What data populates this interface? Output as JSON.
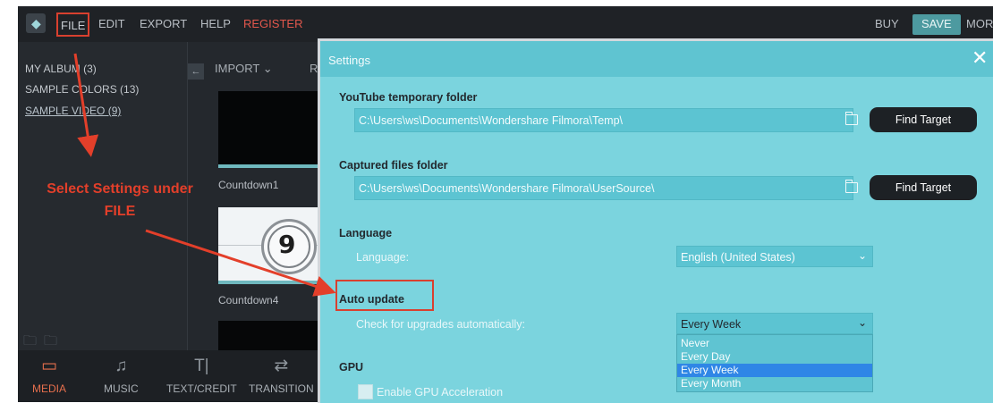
{
  "menubar": {
    "items": [
      "FILE",
      "EDIT",
      "EXPORT",
      "HELP",
      "REGISTER"
    ],
    "right": [
      "BUY",
      "SAVE",
      "MOR"
    ]
  },
  "library": {
    "albums": [
      "MY ALBUM (3)",
      "SAMPLE COLORS (13)",
      "SAMPLE VIDEO (9)"
    ]
  },
  "media": {
    "import_label": "IMPORT ⌄",
    "next_label_fragment": "R",
    "thumbnails": [
      "Countdown1",
      "Countdown4"
    ],
    "thumb_number": "9"
  },
  "bottom_tabs": [
    "MEDIA",
    "MUSIC",
    "TEXT/CREDIT",
    "TRANSITION"
  ],
  "annotation": {
    "line1": "Select Settings under",
    "line2": "FILE",
    "color": "#e33f2a"
  },
  "dialog": {
    "title": "Settings",
    "youtube": {
      "heading": "YouTube temporary folder",
      "path": "C:\\Users\\ws\\Documents\\Wondershare Filmora\\Temp\\",
      "button": "Find Target"
    },
    "captured": {
      "heading": "Captured files folder",
      "path": "C:\\Users\\ws\\Documents\\Wondershare Filmora\\UserSource\\",
      "button": "Find Target"
    },
    "language": {
      "heading": "Language",
      "label": "Language:",
      "value": "English (United States)"
    },
    "auto_update": {
      "heading": "Auto update",
      "label": "Check for upgrades automatically:",
      "value": "Every Week",
      "options": [
        "Never",
        "Every Day",
        "Every Week",
        "Every Month"
      ],
      "selected_index": 2
    },
    "gpu": {
      "heading": "GPU",
      "checkbox_label": "Enable GPU Acceleration",
      "checked": false
    }
  },
  "colors": {
    "dialog_bg": "#7bd4de",
    "app_bg": "#24282d",
    "accent_red": "#d9402f",
    "selection_blue": "#2f86e6"
  }
}
